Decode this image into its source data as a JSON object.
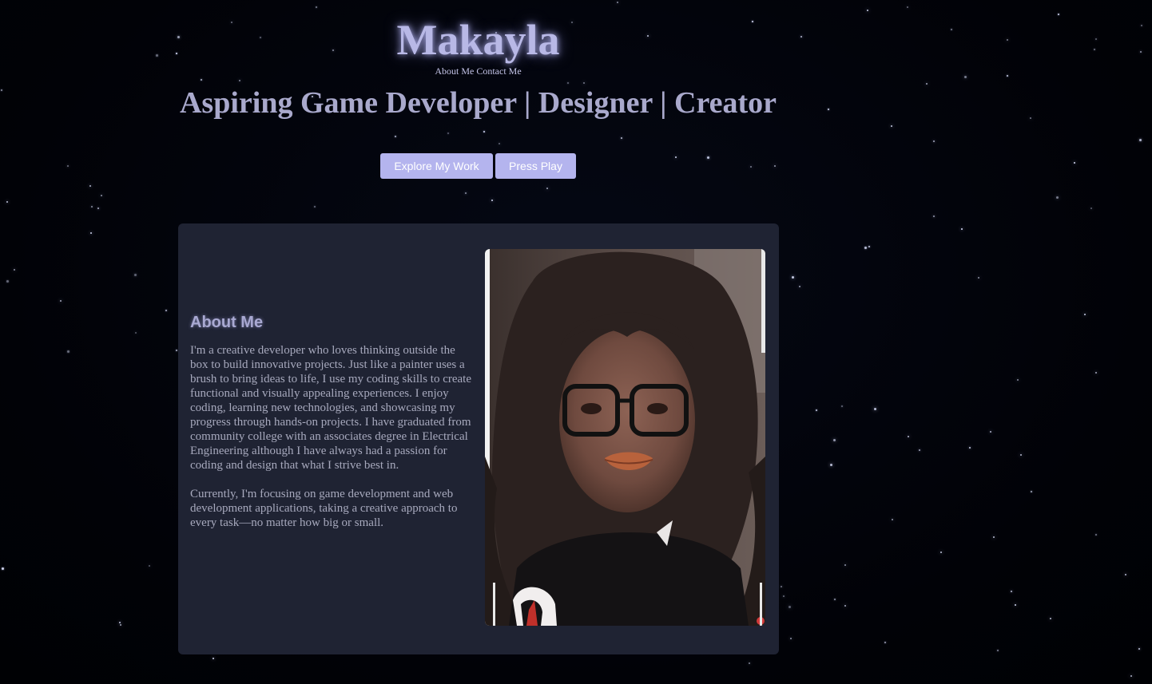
{
  "header": {
    "brand": "Makayla",
    "nav": {
      "about": "About Me",
      "contact": "Contact Me"
    },
    "tagline": "Aspiring Game Developer | Designer | Creator"
  },
  "buttons": {
    "explore": "Explore My Work",
    "play": "Press Play"
  },
  "about": {
    "heading": "About Me",
    "paragraphs": [
      "I'm a creative developer who loves thinking outside the box to build innovative projects. Just like a painter uses a brush to bring ideas to life, I use my coding skills to create functional and visually appealing experiences. I enjoy coding, learning new technologies, and showcasing my progress through hands-on projects. I have graduated from community college with an associates degree in Electrical Engineering although I have always had a passion for coding and design that what I strive best in.",
      "Currently, I'm focusing on game development and web development applications, taking a creative approach to every task—no matter how big or small."
    ]
  },
  "colors": {
    "background": "#000208",
    "card": "#1f2333",
    "accent": "#b4b4ee",
    "brand_glow": "#b8b8e6"
  },
  "icons": {
    "photo": "portrait-photo"
  }
}
